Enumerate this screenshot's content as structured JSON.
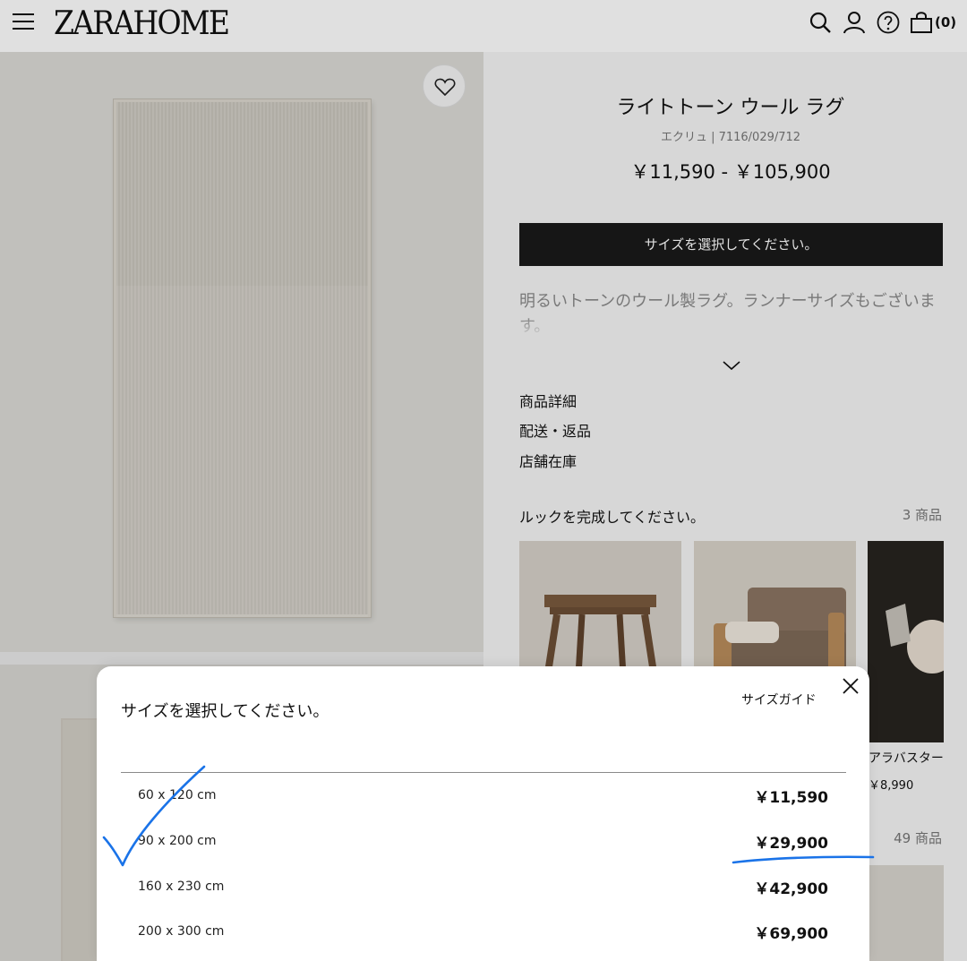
{
  "header": {
    "logo": "ZARA HOME",
    "cart_count": "(0)",
    "icons": [
      "menu-icon",
      "search-icon",
      "account-icon",
      "help-icon",
      "bag-icon"
    ]
  },
  "product": {
    "title": "ライトトーン ウール ラグ",
    "subtitle": "エクリュ | 7116/029/712",
    "price_range": "￥11,590 - ￥105,900",
    "select_size_button": "サイズを選択してください。",
    "description": "明るいトーンのウール製ラグ。ランナーサイズもございます。",
    "links": [
      "商品詳細",
      "配送・返品",
      "店舗在庫"
    ]
  },
  "complete_look": {
    "title": "ルックを完成してください。",
    "count": "3 商品",
    "third_item_name": "アラバスター",
    "third_item_price": "￥8,990"
  },
  "more_items": {
    "count": "49 商品"
  },
  "size_modal": {
    "title": "サイズを選択してください。",
    "size_guide": "サイズガイド",
    "sizes": [
      {
        "label": "60 x 120 cm",
        "price": "￥11,590"
      },
      {
        "label": "90 x 200 cm",
        "price": "￥29,900"
      },
      {
        "label": "160 x 230 cm",
        "price": "￥42,900"
      },
      {
        "label": "200 x 300 cm",
        "price": "￥69,900"
      }
    ]
  },
  "colors": {
    "annotation_blue": "#1a73e8",
    "select_bar": "#1a1a1a"
  }
}
